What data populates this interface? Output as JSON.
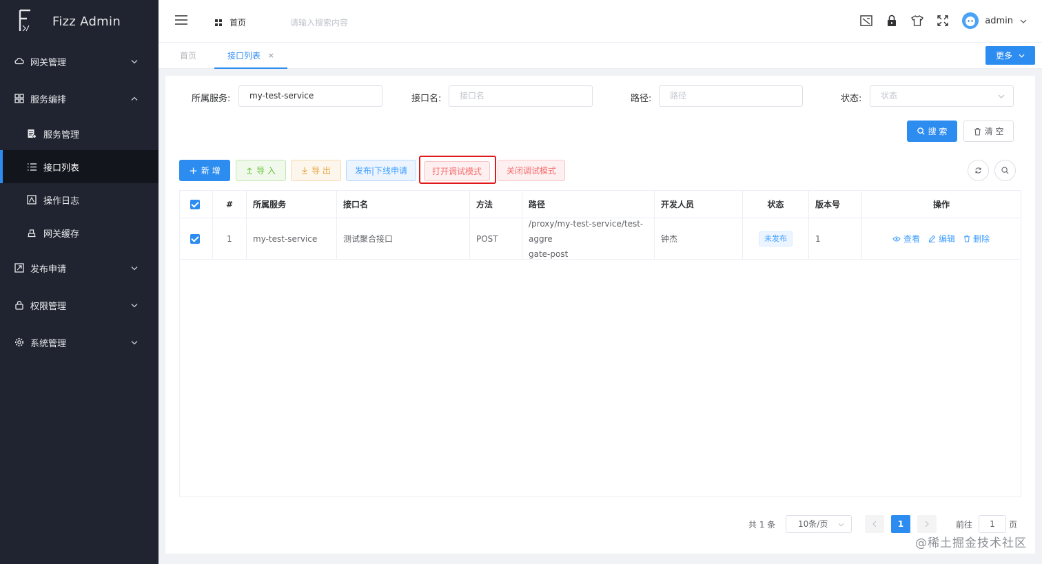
{
  "app": {
    "name": "Fizz Admin"
  },
  "sidebar": {
    "items": [
      {
        "label": "网关管理",
        "icon": "cloud-icon"
      },
      {
        "label": "服务编排",
        "icon": "grid-icon",
        "expanded": true,
        "children": [
          {
            "label": "服务管理",
            "icon": "document-icon"
          },
          {
            "label": "接口列表",
            "icon": "list-icon",
            "active": true
          },
          {
            "label": "操作日志",
            "icon": "log-icon"
          },
          {
            "label": "网关缓存",
            "icon": "cache-icon"
          }
        ]
      },
      {
        "label": "发布申请",
        "icon": "publish-icon"
      },
      {
        "label": "权限管理",
        "icon": "lock-icon"
      },
      {
        "label": "系统管理",
        "icon": "gear-icon"
      }
    ]
  },
  "header": {
    "breadcrumb": "首页",
    "search_placeholder": "请输入搜索内容",
    "user": "admin"
  },
  "tabs": {
    "home": "首页",
    "active": "接口列表",
    "close": "×",
    "more": "更多"
  },
  "filters": {
    "service_label": "所属服务:",
    "service_value": "my-test-service",
    "api_label": "接口名:",
    "api_placeholder": "接口名",
    "path_label": "路径:",
    "path_placeholder": "路径",
    "status_label": "状态:",
    "status_placeholder": "状态"
  },
  "actions": {
    "search": "搜 索",
    "clear": "清 空",
    "new": "新 增",
    "import": "导 入",
    "export": "导 出",
    "publish": "发布|下线申请",
    "debug_on": "打开调试模式",
    "debug_off": "关闭调试模式"
  },
  "table": {
    "columns": [
      "#",
      "所属服务",
      "接口名",
      "方法",
      "路径",
      "开发人员",
      "状态",
      "版本号",
      "操作"
    ],
    "rows": [
      {
        "index": "1",
        "service": "my-test-service",
        "name": "测试聚合接口",
        "method": "POST",
        "path_line1": "/proxy/my-test-service/test-aggre",
        "path_line2": "gate-post",
        "developer": "钟杰",
        "status": "未发布",
        "version": "1"
      }
    ],
    "ops": {
      "view": "查看",
      "edit": "编辑",
      "delete": "删除"
    }
  },
  "pagination": {
    "total": "共 1 条",
    "page_size": "10条/页",
    "current": "1",
    "goto_label": "前往",
    "goto_value": "1",
    "page_unit": "页"
  },
  "watermark": "@稀土掘金技术社区",
  "colors": {
    "primary": "#2d8cf0",
    "sidebar": "#1f2430",
    "danger": "#f56c6c",
    "highlight": "#e0191b"
  }
}
